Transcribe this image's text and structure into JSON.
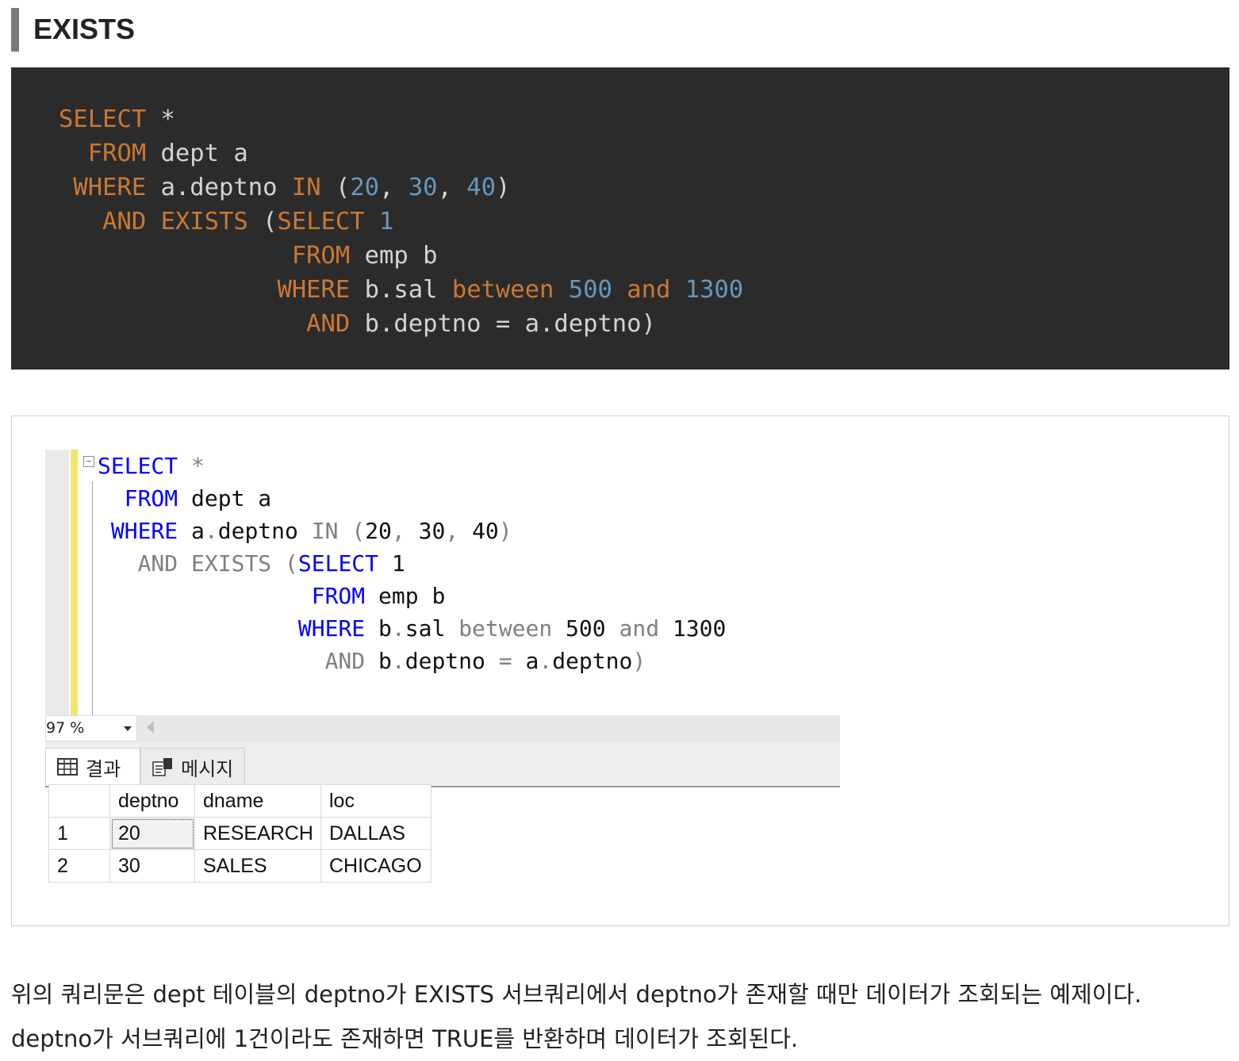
{
  "section_title": "EXISTS",
  "code": [
    [
      [
        "k",
        "SELECT"
      ],
      [
        "t",
        " *"
      ]
    ],
    [
      [
        "t",
        "  "
      ],
      [
        "k",
        "FROM"
      ],
      [
        "t",
        " dept a"
      ]
    ],
    [
      [
        "t",
        " "
      ],
      [
        "k",
        "WHERE"
      ],
      [
        "t",
        " a.deptno "
      ],
      [
        "k",
        "IN"
      ],
      [
        "t",
        " ("
      ],
      [
        "n",
        "20"
      ],
      [
        "t",
        ", "
      ],
      [
        "n",
        "30"
      ],
      [
        "t",
        ", "
      ],
      [
        "n",
        "40"
      ],
      [
        "t",
        ")"
      ]
    ],
    [
      [
        "t",
        "   "
      ],
      [
        "k",
        "AND"
      ],
      [
        "t",
        " "
      ],
      [
        "k",
        "EXISTS"
      ],
      [
        "t",
        " ("
      ],
      [
        "k",
        "SELECT"
      ],
      [
        "t",
        " "
      ],
      [
        "n",
        "1"
      ]
    ],
    [
      [
        "t",
        "                "
      ],
      [
        "k",
        "FROM"
      ],
      [
        "t",
        " emp b"
      ]
    ],
    [
      [
        "t",
        "               "
      ],
      [
        "k",
        "WHERE"
      ],
      [
        "t",
        " b.sal "
      ],
      [
        "k",
        "between"
      ],
      [
        "t",
        " "
      ],
      [
        "n",
        "500"
      ],
      [
        "t",
        " "
      ],
      [
        "k",
        "and"
      ],
      [
        "t",
        " "
      ],
      [
        "n",
        "1300"
      ]
    ],
    [
      [
        "t",
        "                 "
      ],
      [
        "k",
        "AND"
      ],
      [
        "t",
        " b.deptno = a.deptno)"
      ]
    ]
  ],
  "editor_code": [
    [
      [
        "b",
        "SELECT"
      ],
      [
        "g",
        " *"
      ]
    ],
    [
      [
        "d",
        "  "
      ],
      [
        "b",
        "FROM"
      ],
      [
        "d",
        " dept a"
      ]
    ],
    [
      [
        "d",
        " "
      ],
      [
        "b",
        "WHERE"
      ],
      [
        "d",
        " a"
      ],
      [
        "g",
        "."
      ],
      [
        "d",
        "deptno "
      ],
      [
        "g",
        "IN ("
      ],
      [
        "d",
        "20"
      ],
      [
        "g",
        ", "
      ],
      [
        "d",
        "30"
      ],
      [
        "g",
        ", "
      ],
      [
        "d",
        "40"
      ],
      [
        "g",
        ")"
      ]
    ],
    [
      [
        "d",
        "   "
      ],
      [
        "g",
        "AND EXISTS ("
      ],
      [
        "b",
        "SELECT"
      ],
      [
        "d",
        " 1"
      ]
    ],
    [
      [
        "d",
        "                "
      ],
      [
        "b",
        "FROM"
      ],
      [
        "d",
        " emp b"
      ]
    ],
    [
      [
        "d",
        "               "
      ],
      [
        "b",
        "WHERE"
      ],
      [
        "d",
        " b"
      ],
      [
        "g",
        "."
      ],
      [
        "d",
        "sal "
      ],
      [
        "g",
        "between"
      ],
      [
        "d",
        " 500 "
      ],
      [
        "g",
        "and"
      ],
      [
        "d",
        " 1300"
      ]
    ],
    [
      [
        "d",
        "                 "
      ],
      [
        "g",
        "AND"
      ],
      [
        "d",
        " b"
      ],
      [
        "g",
        "."
      ],
      [
        "d",
        "deptno "
      ],
      [
        "g",
        "="
      ],
      [
        "d",
        " a"
      ],
      [
        "g",
        "."
      ],
      [
        "d",
        "deptno"
      ],
      [
        "g",
        ")"
      ]
    ]
  ],
  "zoom": "97 %",
  "tabs": {
    "results": "결과",
    "messages": "메시지"
  },
  "grid": {
    "columns": [
      "deptno",
      "dname",
      "loc"
    ],
    "rows": [
      {
        "num": "1",
        "deptno": "20",
        "dname": "RESEARCH",
        "loc": "DALLAS"
      },
      {
        "num": "2",
        "deptno": "30",
        "dname": "SALES",
        "loc": "CHICAGO"
      }
    ]
  },
  "paragraph": [
    "위의 쿼리문은 dept 테이블의 deptno가 EXISTS 서브쿼리에서 deptno가 존재할 때만 데이터가 조회되는 예제이다.",
    "deptno가 서브쿼리에 1건이라도 존재하면 TRUE를 반환하며 데이터가 조회된다."
  ]
}
